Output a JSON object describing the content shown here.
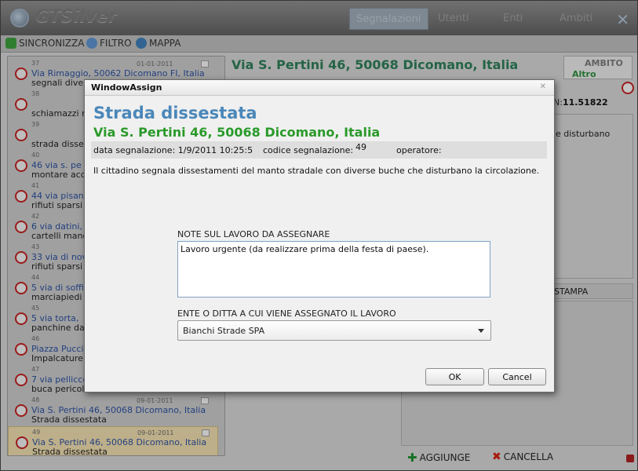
{
  "app": {
    "title": "GTSilver",
    "nav": [
      "Segnalazioni",
      "Utenti",
      "Enti",
      "Ambiti"
    ]
  },
  "toolbar": {
    "sync": "SINCRONIZZA",
    "filter": "FILTRO",
    "map": "MAPPA"
  },
  "list": [
    {
      "num": "37",
      "date": "01-01-2011",
      "addr": "Via Rimaggio, 50062 Dicomano FI, Italia",
      "type": "segnali divelti"
    },
    {
      "num": "38",
      "date": "",
      "addr": "",
      "type": "schiamazzi n"
    },
    {
      "num": "39",
      "date": "",
      "addr": "",
      "type": "strada disse"
    },
    {
      "num": "40",
      "date": "",
      "addr": "46 via s. pe",
      "type": "montare acc"
    },
    {
      "num": "41",
      "date": "",
      "addr": "44 via pisan",
      "type": "rifiuti sparsi"
    },
    {
      "num": "42",
      "date": "",
      "addr": "6 via datini,",
      "type": "cartelli mano"
    },
    {
      "num": "43",
      "date": "",
      "addr": "33 via di nov",
      "type": "rifiuti sparsi"
    },
    {
      "num": "44",
      "date": "",
      "addr": "5 via di soffi",
      "type": "marciapiedi"
    },
    {
      "num": "45",
      "date": "",
      "addr": "5 via torta,",
      "type": "panchine da"
    },
    {
      "num": "46",
      "date": "",
      "addr": "Piazza Puccin",
      "type": "Impalcature"
    },
    {
      "num": "47",
      "date": "",
      "addr": "7 via pellicce",
      "type": "buca pericolo"
    },
    {
      "num": "48",
      "date": "09-01-2011",
      "addr": "Via S. Pertini 46, 50068 Dicomano, Italia",
      "type": "Strada dissestata"
    },
    {
      "num": "49",
      "date": "09-01-2011",
      "addr": "Via S. Pertini 46, 50068 Dicomano, Italia",
      "type": "Strada dissestata"
    }
  ],
  "detail": {
    "title": "Via S. Pertini 46, 50068 Dicomano, Italia",
    "ambito_label": "AMBITO",
    "ambito_value": "Altro",
    "coord_prefix": "N:",
    "coord_value": "11.51822",
    "desc_snippet": "e disturbano",
    "stampa": "STAMPA",
    "aggiunge": "AGGIUNGE",
    "cancella": "CANCELLA"
  },
  "dialog": {
    "window_title": "WindowAssign",
    "title": "Strada dissestata",
    "address": "Via S. Pertini 46, 50068 Dicomano, Italia",
    "date_text": "data segnalazione: 1/9/2011 10:25:5",
    "code_label": "codice segnalazione:",
    "code_value": "49",
    "operator_label": "operatore:",
    "description": "Il cittadino segnala dissestamenti del manto stradale con diverse buche che disturbano la circolazione.",
    "note_label": "NOTE SUL LAVORO DA ASSEGNARE",
    "note_value": "Lavoro urgente (da realizzare prima della festa di paese).",
    "ente_label": "ENTE O DITTA A CUI VIENE ASSEGNATO IL LAVORO",
    "ente_value": "Bianchi Strade SPA",
    "ok": "OK",
    "cancel": "Cancel"
  }
}
